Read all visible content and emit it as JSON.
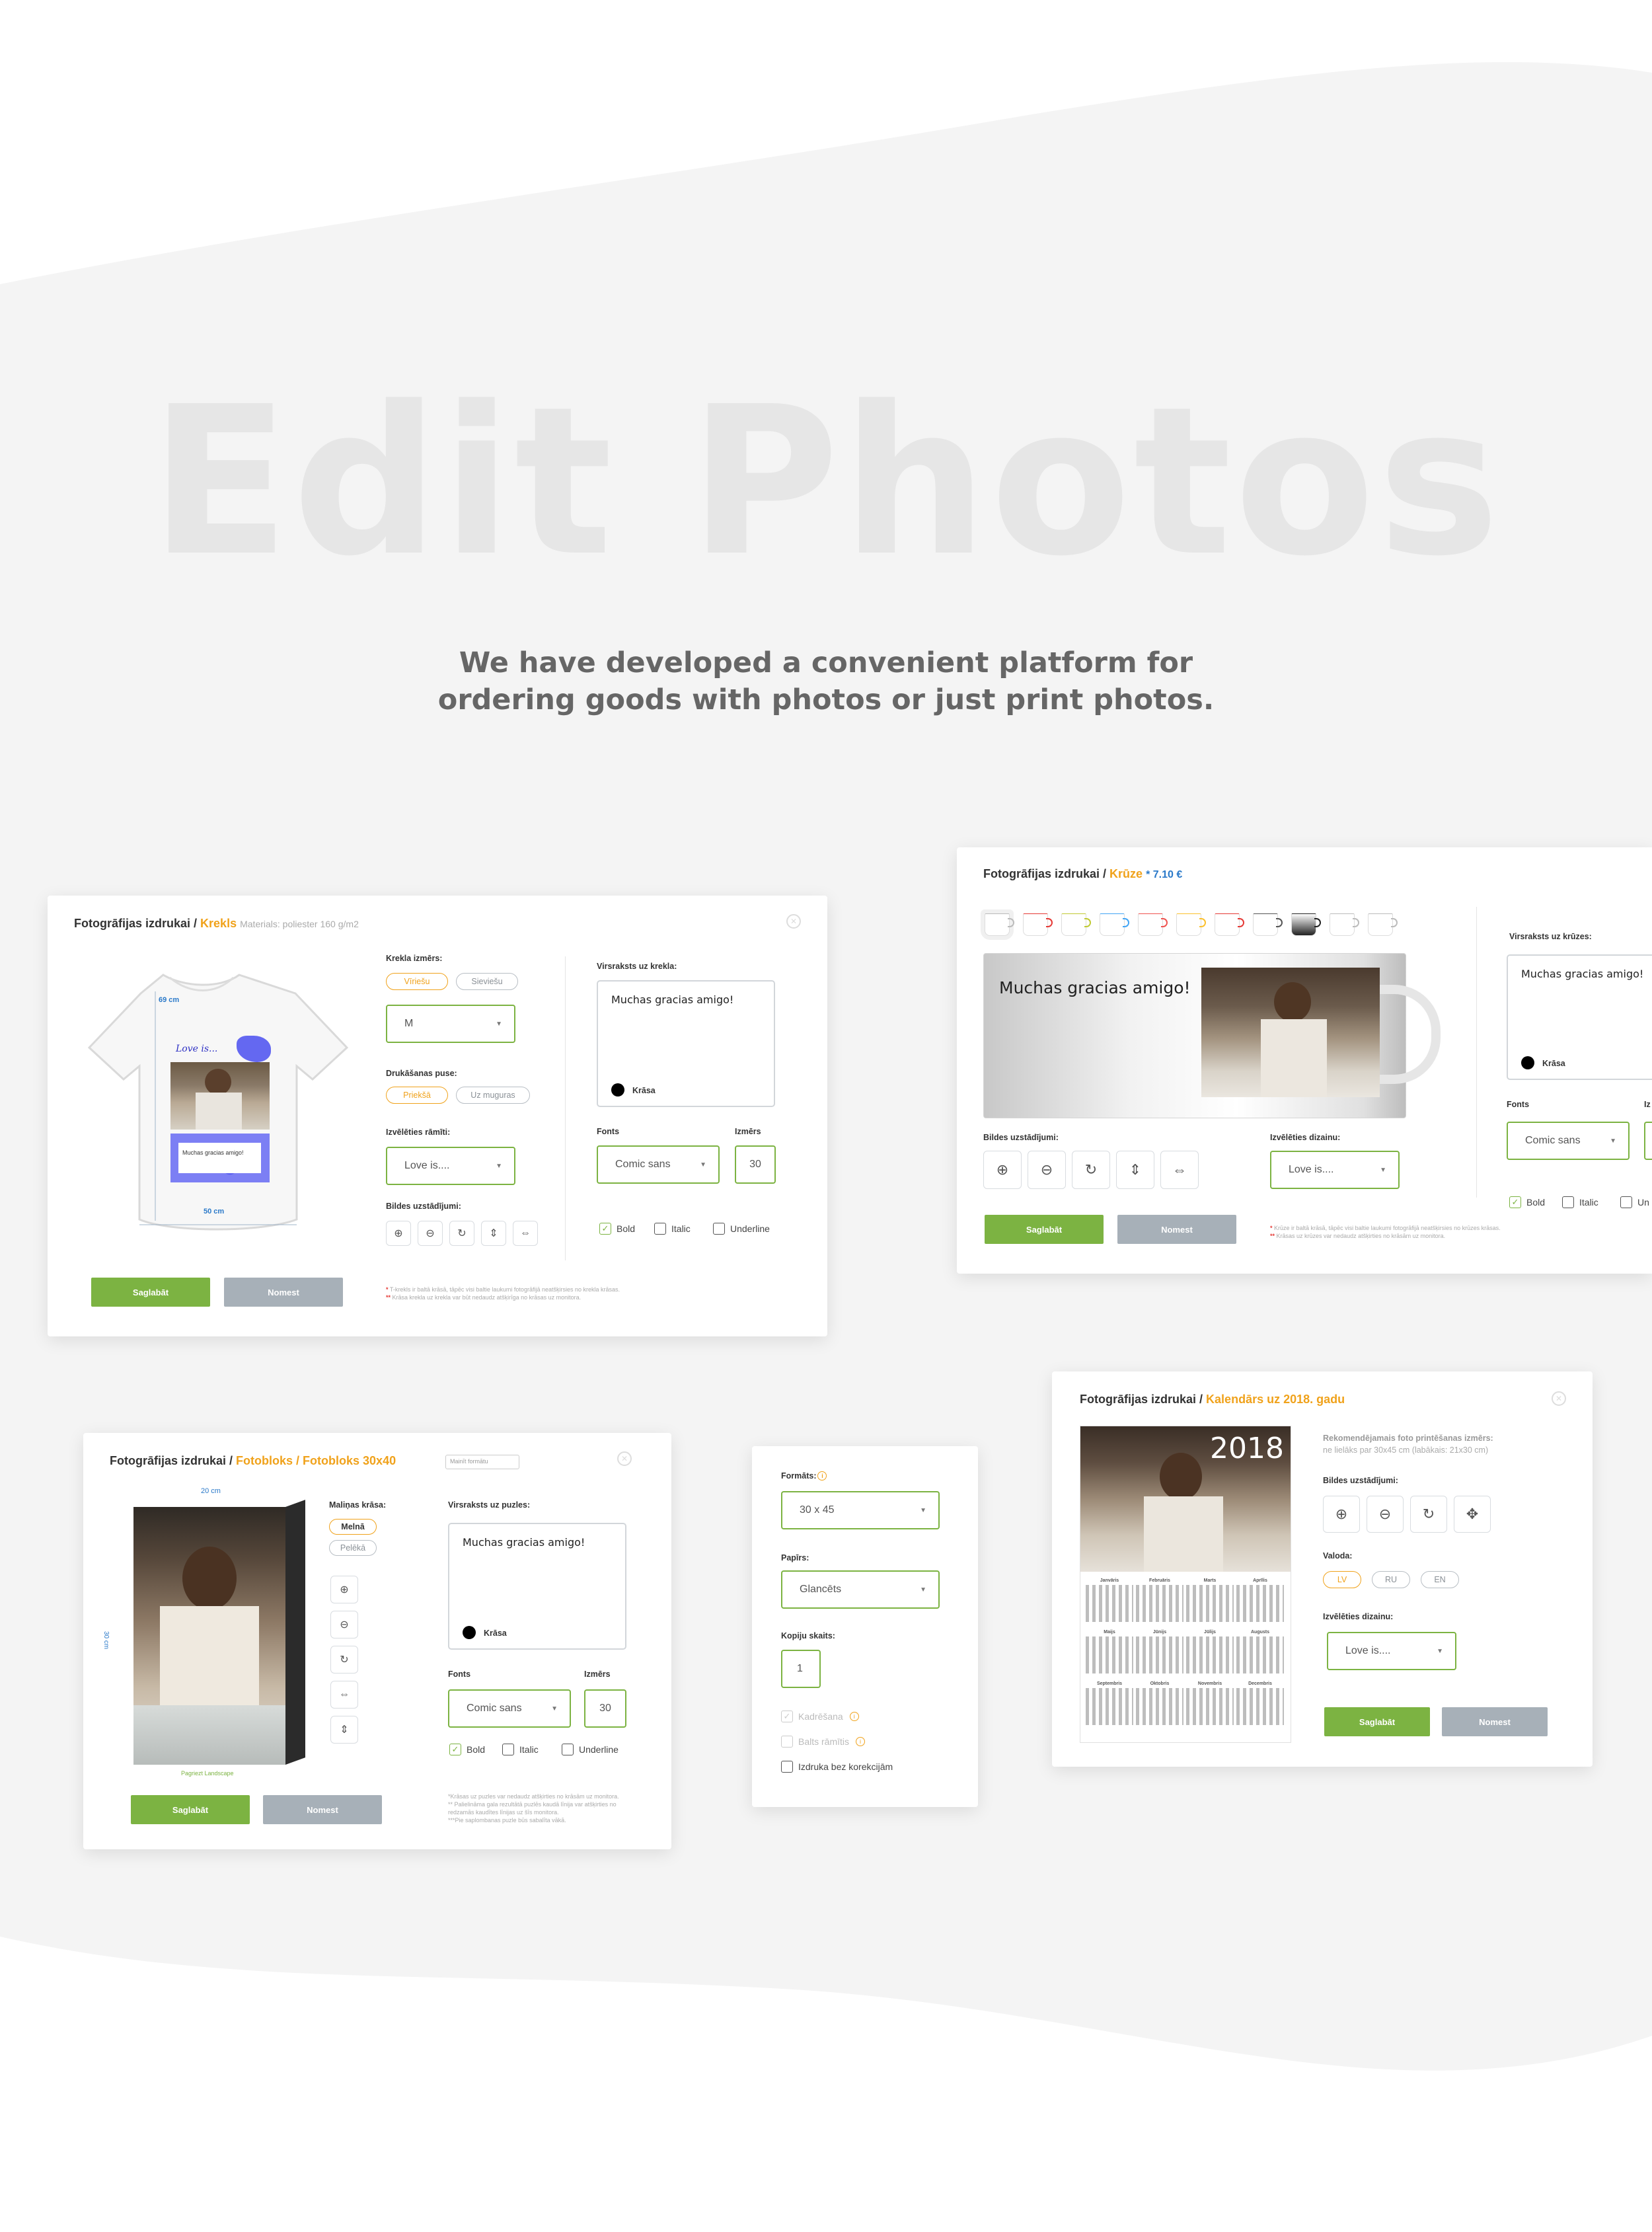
{
  "hero": {
    "title": "Edit Photos",
    "subtitle_line1": "We have developed a convenient platform for",
    "subtitle_line2": "ordering goods with photos or just print photos."
  },
  "colors": {
    "accent_green": "#7cb342",
    "accent_orange": "#f0a21b",
    "price_blue": "#2a79c9",
    "button_gray": "#a7b0b8"
  },
  "tshirt": {
    "title_prefix": "Fotogrāfijas izdrukai /",
    "title_product": "Krekls",
    "title_meta": "Materials: poliester 160 g/m2",
    "height_label": "69 cm",
    "width_label": "50 cm",
    "shirt_text1": "Love is...",
    "shirt_text2": "Muchas gracias amigo!",
    "size_label": "Krekla izmērs:",
    "gender_men": "Vīriešu",
    "gender_women": "Sieviešu",
    "size_value": "M",
    "print_side_label": "Drukāšanas puse:",
    "side_front": "Priekšā",
    "side_back": "Uz muguras",
    "frame_label": "Izvēlēties rāmīti:",
    "frame_value": "Love is....",
    "image_settings_label": "Bildes uzstādījumi:",
    "caption_label": "Virsraksts uz krekla:",
    "caption_text": "Muchas gracias amigo!",
    "color_label": "Krāsa",
    "font_label": "Fonts",
    "font_value": "Comic sans",
    "size_field_label": "Izmērs",
    "size_field_value": "30",
    "bold": "Bold",
    "italic": "Italic",
    "underline": "Underline",
    "save": "Saglabāt",
    "reset": "Nomest",
    "note1": "T-krekls ir baltā krāsā, tāpēc visi baltie laukumi fotogrāfijā neatšķirsies no krekla krāsas.",
    "note2": "Krāsa krekla uz krekla var būt nedaudz atšķirīga no krāsas uz monitora."
  },
  "mug": {
    "title_prefix": "Fotogrāfijas izdrukai /",
    "title_product": "Krūze",
    "price": "* 7.10 €",
    "mug_text": "Muchas gracias amigo!",
    "image_settings_label": "Bildes uzstādījumi:",
    "design_label": "Izvēlēties dizainu:",
    "design_value": "Love is....",
    "caption_label": "Virsraksts uz krūzes:",
    "caption_text": "Muchas gracias amigo!",
    "color_label": "Krāsa",
    "font_label": "Fonts",
    "font_value": "Comic sans",
    "bold": "Bold",
    "italic": "Italic",
    "underline_partial": "Un",
    "size_partial": "Iz",
    "save": "Saglabāt",
    "reset": "Nomest",
    "note1": "Krūze ir baltā krāsā, tāpēc visi baltie laukumi fotogrāfijā neatšķirsies no krūzes krāsas.",
    "note2": "Krāsas uz krūzes var nedaudz atšķirties no krāsām uz monitora.",
    "swatch_colors": [
      "#bbbbbb",
      "#e53935",
      "#c0ca33",
      "#42a5f5",
      "#ef5350",
      "#fbc02d",
      "#e53935",
      "#555555",
      "#222222",
      "#bbbbbb",
      "#bbbbbb"
    ]
  },
  "fotobloks": {
    "title_prefix": "Fotogrāfijas izdrukai /",
    "title_product": "Fotobloks / Fotobloks 30x40",
    "model_placeholder": "Mainīt formātu",
    "width_label": "20 cm",
    "height_label": "30 cm",
    "orientation": "Pagriezt Landscape",
    "edge_color_label": "Maliņas krāsa:",
    "edge_black": "Melnā",
    "edge_gray": "Pelēkā",
    "caption_label": "Virsraksts uz puzles:",
    "caption_text": "Muchas gracias amigo!",
    "color_label": "Krāsa",
    "font_label": "Fonts",
    "font_value": "Comic sans",
    "size_field_label": "Izmērs",
    "size_field_value": "30",
    "bold": "Bold",
    "italic": "Italic",
    "underline": "Underline",
    "save": "Saglabāt",
    "reset": "Nomest",
    "note1": "*Krāsas uz puzles var nedaudz atšķirties no krāsām uz monitora.",
    "note2": "** Palielināma gala rezultātā puzlēs kaudā līnija var atšķirties no",
    "note3": "redzamās kaudītes līnijas uz šīs monitora.",
    "note4": "***Pie saplombanas puzle būs sabalīta vākā."
  },
  "format": {
    "format_label": "Formāts:",
    "format_value": "30 x 45",
    "paper_label": "Papīrs:",
    "paper_value": "Glancēts",
    "copies_label": "Kopiju skaits:",
    "copies_value": "1",
    "crop": "Kadrēšana",
    "white_frame": "Balts rāmītis",
    "no_correction": "Izdruka bez korekcijām"
  },
  "calendar": {
    "title_prefix": "Fotogrāfijas izdrukai /",
    "title_product": "Kalendārs uz 2018. gadu",
    "year": "2018",
    "rec_line1": "Rekomendējamais foto printēšanas izmērs:",
    "rec_line2": "ne lielāks par 30x45 cm (labākais: 21x30 cm)",
    "image_settings_label": "Bildes uzstādījumi:",
    "language_label": "Valoda:",
    "lang_lv": "LV",
    "lang_ru": "RU",
    "lang_en": "EN",
    "design_label": "Izvēlēties dizainu:",
    "design_value": "Love is....",
    "save": "Saglabāt",
    "reset": "Nomest",
    "months": [
      "Janvāris",
      "Februāris",
      "Marts",
      "Aprīlis",
      "Maijs",
      "Jūnijs",
      "Jūlijs",
      "Augusts",
      "Septembris",
      "Oktobris",
      "Novembris",
      "Decembris"
    ]
  }
}
